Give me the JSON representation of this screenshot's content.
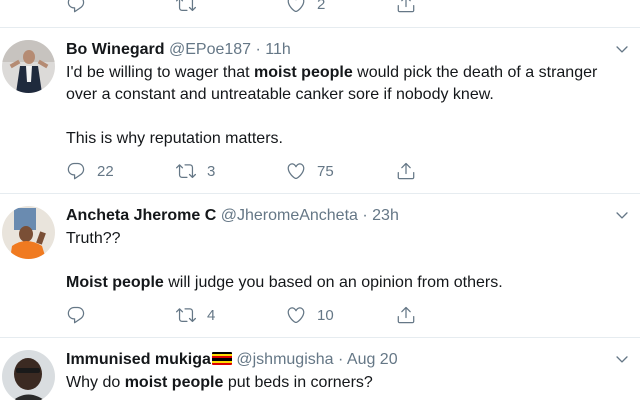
{
  "top_tweet_actions": {
    "reply_count": "",
    "retweet_count": "",
    "like_count": "2"
  },
  "tweets": [
    {
      "name": "Bo Winegard",
      "handle": "@EPoe187",
      "dot": "·",
      "time": "11h",
      "line1_a": "I'd be willing to wager that ",
      "line1_b": "moist people",
      "line1_c": " would pick the death of a stranger",
      "line2": "over a constant and untreatable canker sore if nobody knew.",
      "line3": "This is why reputation matters.",
      "reply_count": "22",
      "retweet_count": "3",
      "like_count": "75"
    },
    {
      "name": "Ancheta Jherome C",
      "handle": "@JheromeAncheta",
      "dot": "·",
      "time": "23h",
      "line1": "Truth??",
      "line2_b": "Moist people",
      "line2_c": " will judge you based on an opinion from others.",
      "reply_count": "",
      "retweet_count": "4",
      "like_count": "10"
    },
    {
      "name": "Immunised mukiga",
      "handle": "@jshmugisha",
      "dot": "·",
      "time": "Aug 20",
      "line1_a": "Why do ",
      "line1_b": "moist people",
      "line1_c": " put beds in corners?"
    }
  ],
  "colors": {
    "text": "#14171a",
    "muted": "#657786",
    "divider": "#e6ecf0"
  },
  "icons": [
    "reply-icon",
    "retweet-icon",
    "like-icon",
    "share-icon",
    "chevron-down-icon",
    "uganda-flag-emoji"
  ]
}
